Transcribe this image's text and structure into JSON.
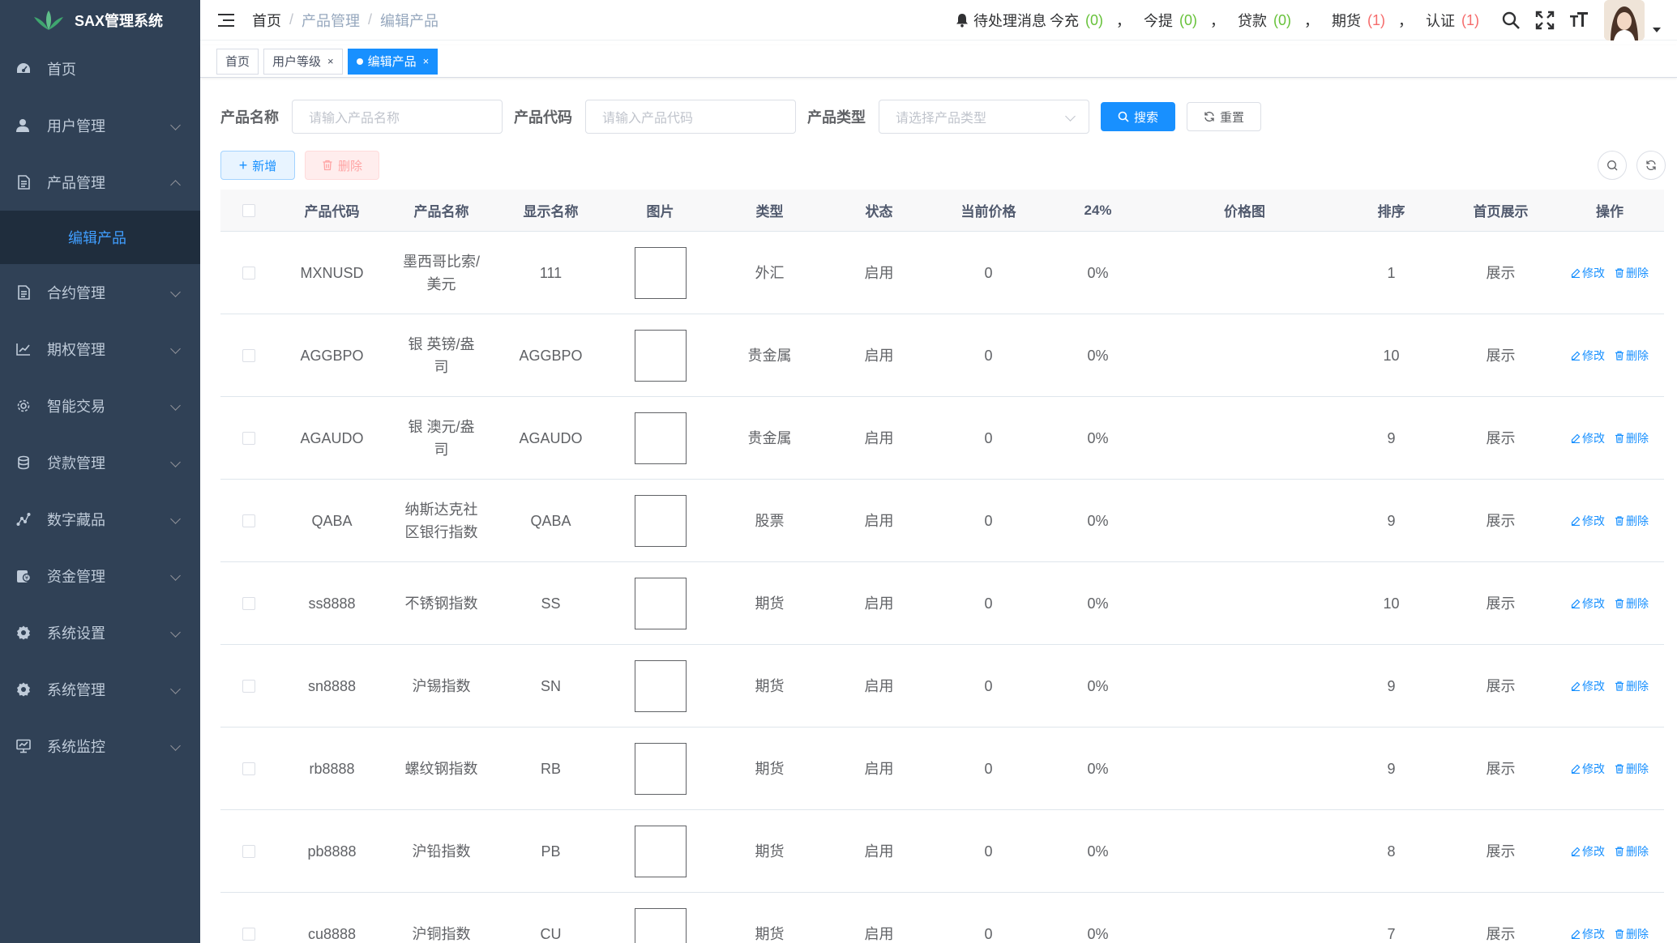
{
  "app": {
    "title": "SAX管理系统"
  },
  "sidebar": {
    "items": [
      {
        "label": "首页",
        "icon": "dashboard-icon",
        "has_children": false
      },
      {
        "label": "用户管理",
        "icon": "user-icon",
        "has_children": true
      },
      {
        "label": "产品管理",
        "icon": "document-icon",
        "has_children": true,
        "expanded": true
      },
      {
        "label": "合约管理",
        "icon": "document-icon",
        "has_children": true
      },
      {
        "label": "期权管理",
        "icon": "chart-icon",
        "has_children": true
      },
      {
        "label": "智能交易",
        "icon": "gear-icon",
        "has_children": true
      },
      {
        "label": "贷款管理",
        "icon": "coins-icon",
        "has_children": true
      },
      {
        "label": "数字藏品",
        "icon": "line-chart-icon",
        "has_children": true
      },
      {
        "label": "资金管理",
        "icon": "money-icon",
        "has_children": true
      },
      {
        "label": "系统设置",
        "icon": "settings-icon",
        "has_children": true
      },
      {
        "label": "系统管理",
        "icon": "settings-icon",
        "has_children": true
      },
      {
        "label": "系统监控",
        "icon": "monitor-icon",
        "has_children": true
      }
    ],
    "active_sub": "编辑产品"
  },
  "breadcrumb": [
    "首页",
    "产品管理",
    "编辑产品"
  ],
  "notice": {
    "prefix": "待处理消息",
    "items": [
      {
        "label": "今充",
        "count": "(0)",
        "color": "green"
      },
      {
        "label": "今提",
        "count": "(0)",
        "color": "green"
      },
      {
        "label": "贷款",
        "count": "(0)",
        "color": "green"
      },
      {
        "label": "期货",
        "count": "(1)",
        "color": "red"
      },
      {
        "label": "认证",
        "count": "(1)",
        "color": "red"
      }
    ],
    "separator": "，"
  },
  "tags": [
    {
      "label": "首页",
      "active": false,
      "closable": false
    },
    {
      "label": "用户等级",
      "active": false,
      "closable": true
    },
    {
      "label": "编辑产品",
      "active": true,
      "closable": true
    }
  ],
  "search": {
    "name_label": "产品名称",
    "name_placeholder": "请输入产品名称",
    "code_label": "产品代码",
    "code_placeholder": "请输入产品代码",
    "type_label": "产品类型",
    "type_placeholder": "请选择产品类型",
    "search_btn": "搜索",
    "reset_btn": "重置"
  },
  "toolbar": {
    "add": "新增",
    "delete": "删除"
  },
  "table": {
    "headers": {
      "code": "产品代码",
      "name": "产品名称",
      "display": "显示名称",
      "image": "图片",
      "type": "类型",
      "status": "状态",
      "price": "当前价格",
      "pct": "24%",
      "chart": "价格图",
      "sort": "排序",
      "home": "首页展示",
      "ops": "操作"
    },
    "edit_label": "修改",
    "delete_label": "删除",
    "rows": [
      {
        "code": "MXNUSD",
        "name": "墨西哥比索/美元",
        "display": "111",
        "type": "外汇",
        "status": "启用",
        "price": "0",
        "pct": "0%",
        "sort": "1",
        "home": "展示"
      },
      {
        "code": "AGGBPO",
        "name": "银 英镑/盎司",
        "display": "AGGBPO",
        "type": "贵金属",
        "status": "启用",
        "price": "0",
        "pct": "0%",
        "sort": "10",
        "home": "展示"
      },
      {
        "code": "AGAUDO",
        "name": "银 澳元/盎司",
        "display": "AGAUDO",
        "type": "贵金属",
        "status": "启用",
        "price": "0",
        "pct": "0%",
        "sort": "9",
        "home": "展示"
      },
      {
        "code": "QABA",
        "name": "纳斯达克社区银行指数",
        "display": "QABA",
        "type": "股票",
        "status": "启用",
        "price": "0",
        "pct": "0%",
        "sort": "9",
        "home": "展示"
      },
      {
        "code": "ss8888",
        "name": "不锈钢指数",
        "display": "SS",
        "type": "期货",
        "status": "启用",
        "price": "0",
        "pct": "0%",
        "sort": "10",
        "home": "展示"
      },
      {
        "code": "sn8888",
        "name": "沪锡指数",
        "display": "SN",
        "type": "期货",
        "status": "启用",
        "price": "0",
        "pct": "0%",
        "sort": "9",
        "home": "展示"
      },
      {
        "code": "rb8888",
        "name": "螺纹钢指数",
        "display": "RB",
        "type": "期货",
        "status": "启用",
        "price": "0",
        "pct": "0%",
        "sort": "9",
        "home": "展示"
      },
      {
        "code": "pb8888",
        "name": "沪铅指数",
        "display": "PB",
        "type": "期货",
        "status": "启用",
        "price": "0",
        "pct": "0%",
        "sort": "8",
        "home": "展示"
      },
      {
        "code": "cu8888",
        "name": "沪铜指数",
        "display": "CU",
        "type": "期货",
        "status": "启用",
        "price": "0",
        "pct": "0%",
        "sort": "7",
        "home": "展示"
      }
    ]
  },
  "colors": {
    "sidebar_bg": "#304156",
    "primary": "#1890ff",
    "green": "#67c23a",
    "red": "#f56c6c"
  }
}
